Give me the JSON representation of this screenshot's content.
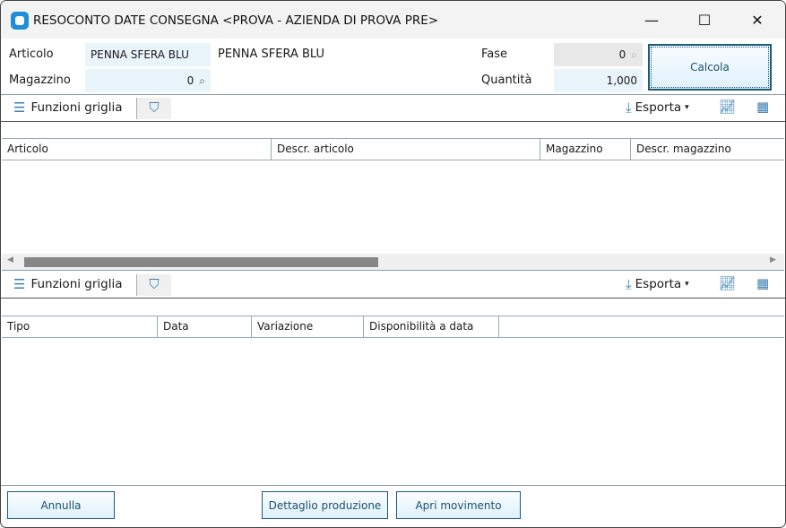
{
  "window": {
    "title": "RESOCONTO DATE CONSEGNA <PROVA - AZIENDA DI PROVA PRE>",
    "minimize": "—",
    "maximize": "☐",
    "close": "✕"
  },
  "form": {
    "articolo_label": "Articolo",
    "articolo_value": "PENNA SFERA BLU",
    "articolo_descr": "PENNA SFERA BLU",
    "magazzino_label": "Magazzino",
    "magazzino_value": "0",
    "fase_label": "Fase",
    "fase_value": "0",
    "quantita_label": "Quantità",
    "quantita_value": "1,000",
    "calcola": "Calcola"
  },
  "grid1": {
    "functions": "Funzioni griglia",
    "export": "Esporta",
    "columns": [
      "Articolo",
      "Descr. articolo",
      "Magazzino",
      "Descr. magazzino"
    ]
  },
  "grid2": {
    "functions": "Funzioni griglia",
    "export": "Esporta",
    "columns": [
      "Tipo",
      "Data",
      "Variazione",
      "Disponibilità a data"
    ]
  },
  "footer": {
    "annulla": "Annulla",
    "dettaglio": "Dettaglio produzione",
    "apri": "Apri movimento"
  },
  "icons": {
    "search": "⌕",
    "dropdown": "▾"
  }
}
